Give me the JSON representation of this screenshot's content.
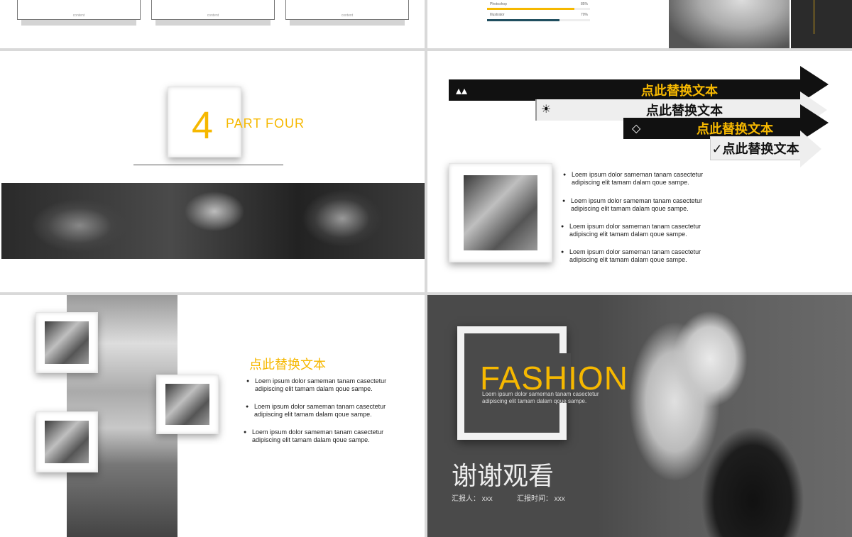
{
  "slide1": {
    "cards": [
      {
        "label": "content"
      },
      {
        "label": "content"
      },
      {
        "label": "content"
      }
    ]
  },
  "slide2": {
    "skills": [
      {
        "name": "Photoshop",
        "pct": "85%",
        "value": 0.85,
        "color": "#f6b800"
      },
      {
        "name": "Illustrator",
        "pct": "70%",
        "value": 0.7,
        "color": "#1f4e5f"
      }
    ]
  },
  "slide3": {
    "number": "4",
    "part": "PART FOUR"
  },
  "slide4": {
    "ribbons": [
      {
        "text": "点此替换文本",
        "icon": "droplets-icon",
        "glyph": "▴▴"
      },
      {
        "text": "点此替换文本",
        "icon": "sun-icon",
        "glyph": "☀"
      },
      {
        "text": "点此替换文本",
        "icon": "tag-icon",
        "glyph": "◇"
      },
      {
        "text": "✓点此替换文本",
        "icon": "check-icon",
        "glyph": ""
      }
    ],
    "bullets": [
      [
        "Loem ipsum dolor sameman tanam casectetur",
        "adipiscing elit tamam dalam qoue sampe."
      ],
      [
        "Loem ipsum dolor sameman tanam casectetur",
        "adipiscing elit tamam dalam qoue sampe."
      ],
      [
        "Loem ipsum dolor sameman tanam casectetur",
        "adipiscing elit tamam dalam qoue sampe."
      ],
      [
        "Loem ipsum dolor sameman tanam casectetur",
        "adipiscing elit tamam dalam qoue sampe."
      ]
    ]
  },
  "slide5": {
    "title": "点此替换文本",
    "bullets": [
      [
        "Loem ipsum dolor sameman tanam casectetur",
        "adipiscing elit tamam dalam qoue sampe."
      ],
      [
        "Loem ipsum dolor sameman tanam casectetur",
        "adipiscing elit tamam dalam qoue sampe."
      ],
      [
        "Loem ipsum dolor sameman tanam casectetur",
        "adipiscing elit tamam dalam qoue sampe."
      ]
    ]
  },
  "slide6": {
    "word": "FASHION",
    "sub1": "Loem ipsum dolor sameman tanam casectetur",
    "sub2": "adipiscing elit tamam dalam qoue sampe.",
    "thanks": "谢谢观看",
    "reporter": "汇报人：  xxx",
    "time": "汇报时间：  xxx"
  },
  "colors": {
    "accent": "#f6b800",
    "dark": "#1a1a1a",
    "teal": "#1f4e5f"
  }
}
